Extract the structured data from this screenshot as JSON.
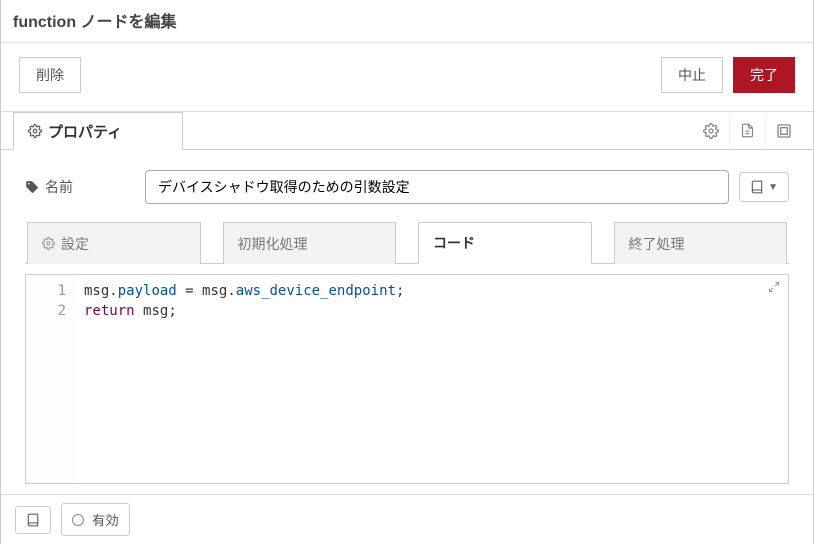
{
  "header": {
    "title": "function ノードを編集"
  },
  "actions": {
    "delete": "削除",
    "cancel": "中止",
    "done": "完了"
  },
  "tabs": {
    "properties": "プロパティ"
  },
  "form": {
    "name_label": "名前",
    "name_value": "デバイスシャドウ取得のための引数設定"
  },
  "code_tabs": {
    "setup": "設定",
    "initialize": "初期化処理",
    "code": "コード",
    "close": "終了処理",
    "active": "code"
  },
  "code": {
    "lines": [
      {
        "n": 1,
        "tokens": [
          {
            "t": "msg",
            "c": "norm"
          },
          {
            "t": ".",
            "c": "norm"
          },
          {
            "t": "payload",
            "c": "prop"
          },
          {
            "t": " = ",
            "c": "norm"
          },
          {
            "t": "msg",
            "c": "norm"
          },
          {
            "t": ".",
            "c": "norm"
          },
          {
            "t": "aws_device_endpoint",
            "c": "prop"
          },
          {
            "t": ";",
            "c": "norm"
          }
        ]
      },
      {
        "n": 2,
        "tokens": [
          {
            "t": "return",
            "c": "kw"
          },
          {
            "t": " ",
            "c": "norm"
          },
          {
            "t": "msg",
            "c": "norm"
          },
          {
            "t": ";",
            "c": "norm"
          }
        ]
      }
    ]
  },
  "footer": {
    "enabled": "有効"
  }
}
